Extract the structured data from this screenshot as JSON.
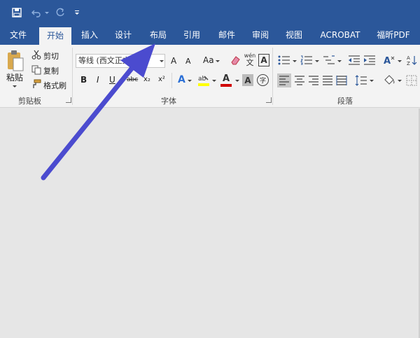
{
  "tabs": [
    "文件",
    "开始",
    "插入",
    "设计",
    "布局",
    "引用",
    "邮件",
    "审阅",
    "视图",
    "ACROBAT",
    "福昕PDF"
  ],
  "clipboard": {
    "paste": "粘贴",
    "cut": "剪切",
    "copy": "复制",
    "format_painter": "格式刷",
    "group_label": "剪贴板"
  },
  "font": {
    "name": "等线 (西文正文",
    "size": "",
    "grow": "A",
    "shrink": "A",
    "change_case": "Aa",
    "bold": "B",
    "italic": "I",
    "underline": "U",
    "strike": "abc",
    "subscript": "x₂",
    "superscript": "x²",
    "pinyin_top": "wén",
    "pinyin_bottom": "文",
    "char_border": "A",
    "text_effect": "A",
    "font_color": "A",
    "char_shading": "A",
    "enclose": "字",
    "group_label": "字体"
  },
  "paragraph": {
    "group_label": "段落"
  },
  "colors": {
    "titlebar": "#2b579a",
    "ribbon": "#f3f3f3",
    "document": "#e6e6e6",
    "arrow": "#4b4bcf",
    "highlight": "#ffff00",
    "font_color": "#d00000"
  },
  "annotation": {
    "points_to": "布局"
  }
}
